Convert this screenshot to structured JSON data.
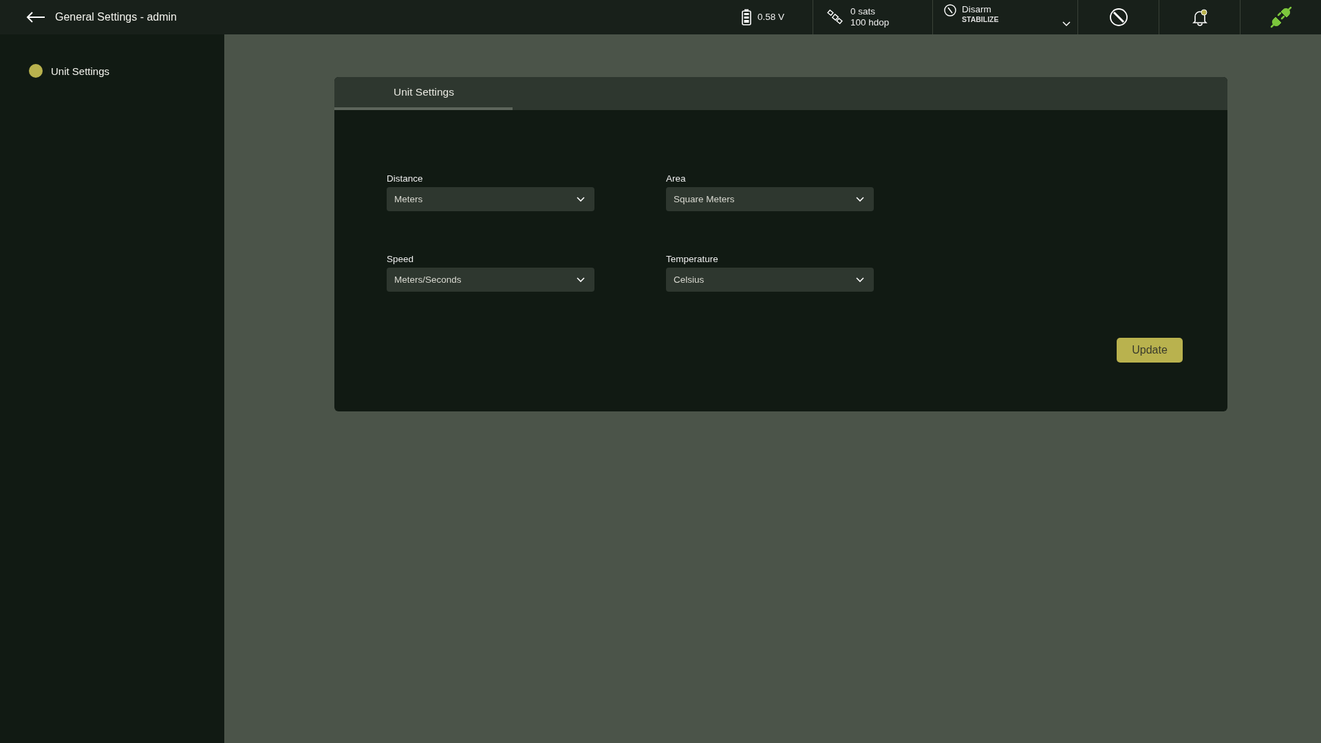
{
  "header": {
    "title": "General Settings - admin"
  },
  "status_bar": {
    "battery": "0.58 V",
    "sats": "0 sats",
    "hdop": "100 hdop",
    "arm_action": "Disarm",
    "flight_mode": "STABILIZE",
    "unread_alerts": true,
    "connected": true
  },
  "sidebar": {
    "items": [
      {
        "label": "Unit Settings",
        "selected": true
      }
    ]
  },
  "tabs": [
    {
      "label": "Unit Settings",
      "selected": true
    }
  ],
  "fields": [
    {
      "label": "Distance",
      "value": "Meters"
    },
    {
      "label": "Area",
      "value": "Square Meters"
    },
    {
      "label": "Speed",
      "value": "Meters/Seconds"
    },
    {
      "label": "Temperature",
      "value": "Celsius"
    }
  ],
  "buttons": [
    {
      "label": "Update"
    }
  ]
}
